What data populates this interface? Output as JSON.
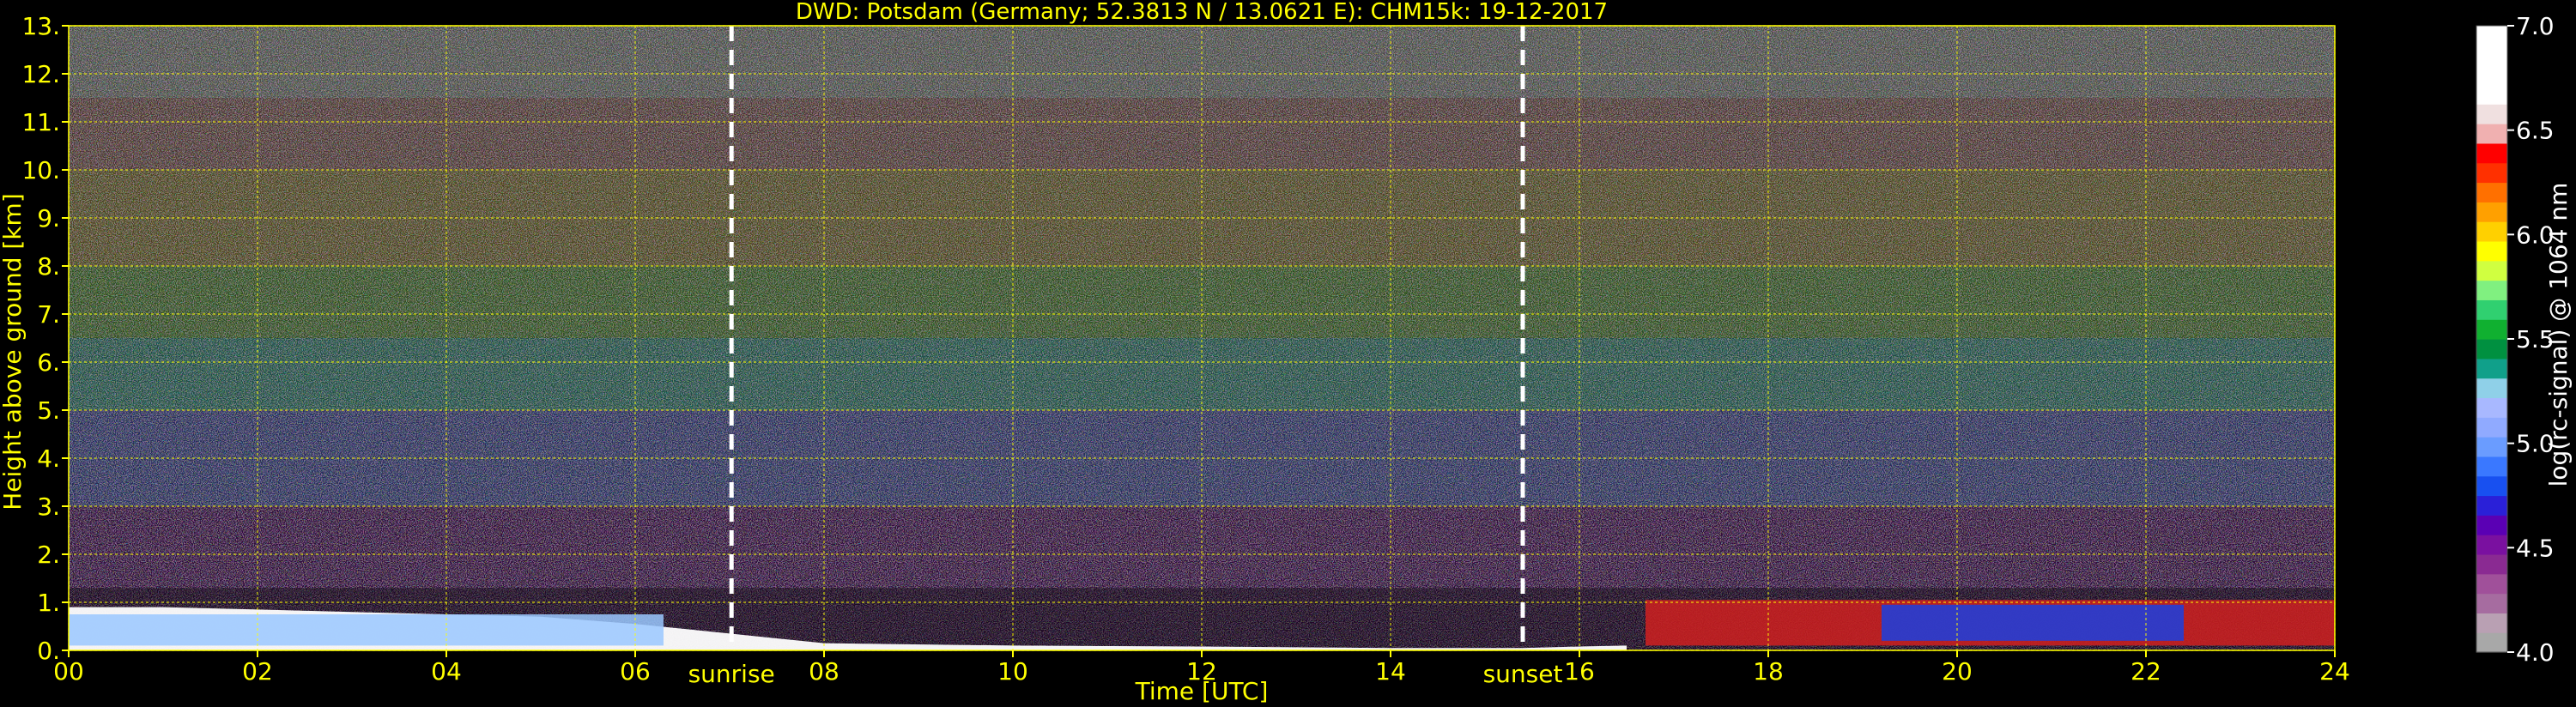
{
  "chart_data": {
    "type": "heatmap",
    "title": "DWD: Potsdam (Germany; 52.3813 N / 13.0621 E):    CHM15k: 19-12-2017",
    "xlabel": "Time [UTC]",
    "ylabel": "Height above ground [km]",
    "xlim": [
      0,
      24
    ],
    "ylim": [
      0,
      13
    ],
    "x_ticks": [
      {
        "value": 0,
        "label": "00"
      },
      {
        "value": 2,
        "label": "02"
      },
      {
        "value": 4,
        "label": "04"
      },
      {
        "value": 6,
        "label": "06"
      },
      {
        "value": 8,
        "label": "08"
      },
      {
        "value": 10,
        "label": "10"
      },
      {
        "value": 12,
        "label": "12"
      },
      {
        "value": 14,
        "label": "14"
      },
      {
        "value": 16,
        "label": "16"
      },
      {
        "value": 18,
        "label": "18"
      },
      {
        "value": 20,
        "label": "20"
      },
      {
        "value": 22,
        "label": "22"
      },
      {
        "value": 24,
        "label": "24"
      }
    ],
    "y_ticks": [
      {
        "value": 0,
        "label": "0."
      },
      {
        "value": 1,
        "label": "1."
      },
      {
        "value": 2,
        "label": "2."
      },
      {
        "value": 3,
        "label": "3."
      },
      {
        "value": 4,
        "label": "4."
      },
      {
        "value": 5,
        "label": "5."
      },
      {
        "value": 6,
        "label": "6."
      },
      {
        "value": 7,
        "label": "7."
      },
      {
        "value": 8,
        "label": "8."
      },
      {
        "value": 9,
        "label": "9."
      },
      {
        "value": 10,
        "label": "10."
      },
      {
        "value": 11,
        "label": "11."
      },
      {
        "value": 12,
        "label": "12."
      },
      {
        "value": 13,
        "label": "13."
      }
    ],
    "grid": true,
    "grid_color": "#ffff00",
    "annotations": [
      {
        "label": "sunrise",
        "x": 7.02
      },
      {
        "label": "sunset",
        "x": 15.4
      }
    ],
    "colorbar": {
      "label": "log(rc-signal) @ 1064 nm",
      "range": [
        4.0,
        7.0
      ],
      "ticks": [
        {
          "value": 4.0,
          "label": "4.0"
        },
        {
          "value": 4.5,
          "label": "4.5"
        },
        {
          "value": 5.0,
          "label": "5.0"
        },
        {
          "value": 5.5,
          "label": "5.5"
        },
        {
          "value": 6.0,
          "label": "6.0"
        },
        {
          "value": 6.5,
          "label": "6.5"
        },
        {
          "value": 7.0,
          "label": "7.0"
        }
      ],
      "colors": [
        "#a8a8a8",
        "#b9a0b3",
        "#a66ca0",
        "#a0509a",
        "#8a2a92",
        "#7a10a0",
        "#5a00b4",
        "#2a20d8",
        "#1850f0",
        "#3a78ff",
        "#6a9cff",
        "#90aaff",
        "#a8b8ff",
        "#8fd0e8",
        "#10a08a",
        "#009040",
        "#10b030",
        "#30d070",
        "#80f080",
        "#d0ff40",
        "#ffff00",
        "#ffd000",
        "#ffa000",
        "#ff7000",
        "#ff3000",
        "#ff0000",
        "#f0b0b0",
        "#f0e0e0",
        "#ffffff",
        "#ffffff",
        "#ffffff",
        "#ffffff"
      ]
    },
    "background_layers": [
      {
        "y0": 0.0,
        "y1": 3.0,
        "color": "#5a1c70"
      },
      {
        "y0": 3.0,
        "y1": 5.0,
        "color": "#4a50a8"
      },
      {
        "y0": 5.0,
        "y1": 6.5,
        "color": "#3a8a80"
      },
      {
        "y0": 6.5,
        "y1": 8.0,
        "color": "#5a8a40"
      },
      {
        "y0": 8.0,
        "y1": 10.0,
        "color": "#8a7a40"
      },
      {
        "y0": 10.0,
        "y1": 11.5,
        "color": "#8a6060"
      },
      {
        "y0": 11.5,
        "y1": 13.0,
        "color": "#8a8a8a"
      }
    ],
    "features": [
      {
        "name": "boundary layer top",
        "points": [
          [
            0,
            0.9
          ],
          [
            1,
            0.9
          ],
          [
            2,
            0.85
          ],
          [
            3,
            0.8
          ],
          [
            4,
            0.75
          ],
          [
            5,
            0.7
          ],
          [
            6,
            0.55
          ],
          [
            6.5,
            0.45
          ],
          [
            7,
            0.35
          ],
          [
            8,
            0.15
          ],
          [
            10,
            0.1
          ],
          [
            12,
            0.08
          ],
          [
            14,
            0.05
          ],
          [
            15.4,
            0.05
          ],
          [
            16,
            0.08
          ],
          [
            16.5,
            0.1
          ]
        ],
        "color": "#ffffff"
      },
      {
        "name": "low cloud layer evening",
        "x0": 16.7,
        "x1": 24.0,
        "y0": 0.1,
        "y1": 1.05,
        "color": "#d02020"
      },
      {
        "name": "cloud layer core",
        "x0": 19.2,
        "x1": 22.4,
        "y0": 0.2,
        "y1": 0.95,
        "color": "#1a40e0"
      },
      {
        "name": "aerosol layer night",
        "x0": 0.0,
        "x1": 6.3,
        "y0": 0.1,
        "y1": 0.75,
        "color": "#9ac8ff"
      }
    ]
  }
}
